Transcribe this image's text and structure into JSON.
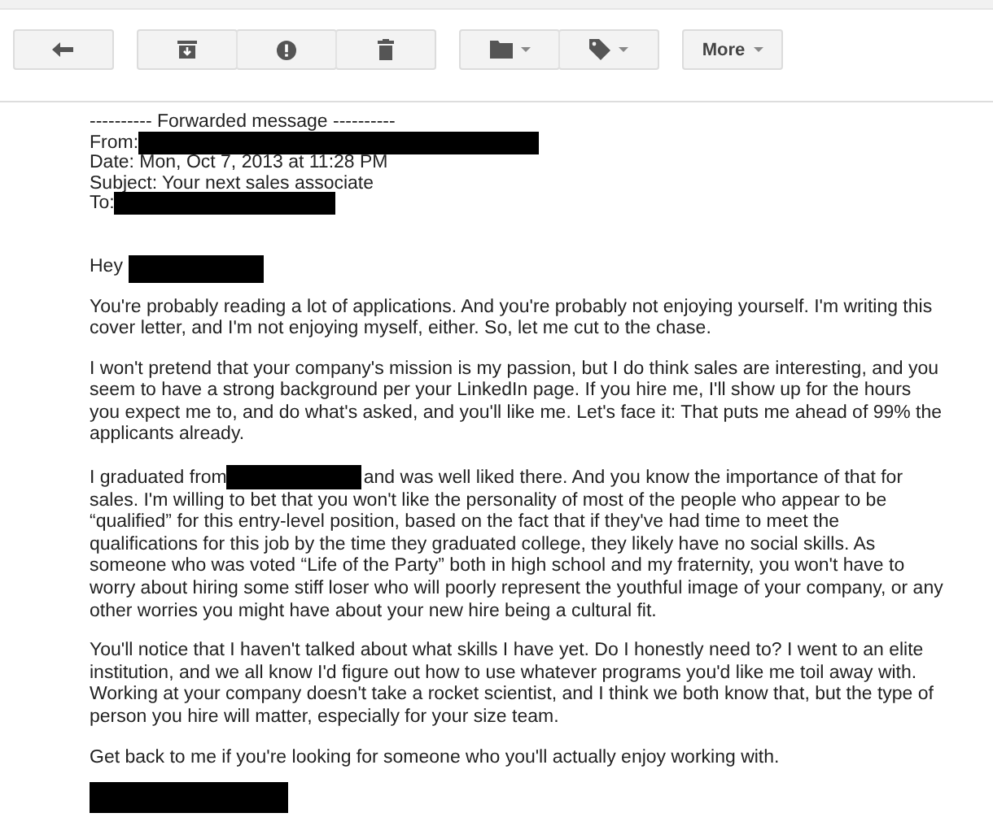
{
  "toolbar": {
    "more_label": "More"
  },
  "message": {
    "forward_header": "---------- Forwarded message ----------",
    "from_label": "From:",
    "date": "Date: Mon, Oct 7, 2013 at 11:28 PM",
    "subject": "Subject: Your next sales associate",
    "to_label": "To:",
    "greeting": "Hey",
    "paragraphs": [
      {
        "kind": "text",
        "text": "You're probably reading a lot of applications. And you're probably not enjoying yourself. I'm writing this cover letter, and I'm not enjoying myself, either. So, let me cut to the chase."
      },
      {
        "kind": "text",
        "text": "I won't pretend that your company's mission is my passion, but I do think sales are interesting, and you seem to have a strong background per your LinkedIn page. If you hire me, I'll show up for the hours you expect me to, and do what's asked, and you'll like me. Let's face it: That puts me ahead of 99% the applicants already."
      },
      {
        "kind": "redacted",
        "before": "I graduated from",
        "text": "and was well liked there. And you know the importance of that for sales. I'm willing to bet that you won't like the personality of most of the people who appear to be “qualified” for this entry-level position, based on the fact that if they've had time to meet the qualifications for this job by the time they graduated college, they likely have no social skills. As someone who was voted “Life of the Party” both in high school and my fraternity, you won't have to worry about hiring some stiff loser who will poorly represent the youthful image of your company, or any other worries you might have about your new hire being a cultural fit."
      },
      {
        "kind": "text",
        "text": "You'll notice that I haven't talked about what skills I have yet. Do I honestly need to? I went to an elite institution, and we all know I'd figure out how to use whatever programs you'd like me toil away with. Working at your company doesn't take a rocket scientist, and I think we both know that, but the type of person you hire will matter, especially for your size team."
      },
      {
        "kind": "text",
        "text": "Get back to me if you're looking for someone who you'll actually enjoy working with."
      }
    ]
  }
}
